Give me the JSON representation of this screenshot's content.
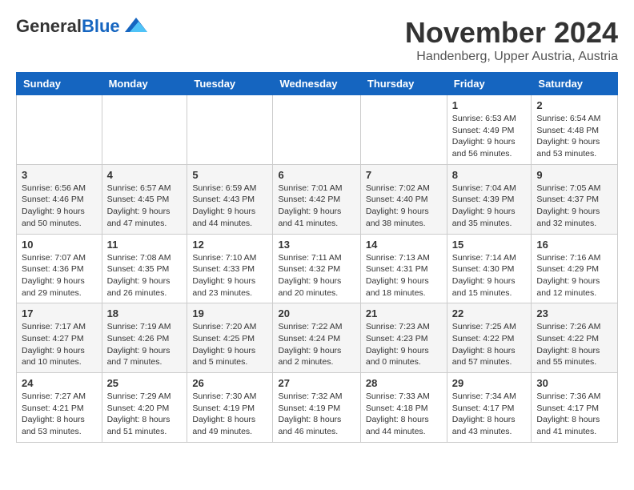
{
  "logo": {
    "general": "General",
    "blue": "Blue"
  },
  "title": "November 2024",
  "location": "Handenberg, Upper Austria, Austria",
  "days_of_week": [
    "Sunday",
    "Monday",
    "Tuesday",
    "Wednesday",
    "Thursday",
    "Friday",
    "Saturday"
  ],
  "weeks": [
    [
      {
        "day": "",
        "info": ""
      },
      {
        "day": "",
        "info": ""
      },
      {
        "day": "",
        "info": ""
      },
      {
        "day": "",
        "info": ""
      },
      {
        "day": "",
        "info": ""
      },
      {
        "day": "1",
        "info": "Sunrise: 6:53 AM\nSunset: 4:49 PM\nDaylight: 9 hours and 56 minutes."
      },
      {
        "day": "2",
        "info": "Sunrise: 6:54 AM\nSunset: 4:48 PM\nDaylight: 9 hours and 53 minutes."
      }
    ],
    [
      {
        "day": "3",
        "info": "Sunrise: 6:56 AM\nSunset: 4:46 PM\nDaylight: 9 hours and 50 minutes."
      },
      {
        "day": "4",
        "info": "Sunrise: 6:57 AM\nSunset: 4:45 PM\nDaylight: 9 hours and 47 minutes."
      },
      {
        "day": "5",
        "info": "Sunrise: 6:59 AM\nSunset: 4:43 PM\nDaylight: 9 hours and 44 minutes."
      },
      {
        "day": "6",
        "info": "Sunrise: 7:01 AM\nSunset: 4:42 PM\nDaylight: 9 hours and 41 minutes."
      },
      {
        "day": "7",
        "info": "Sunrise: 7:02 AM\nSunset: 4:40 PM\nDaylight: 9 hours and 38 minutes."
      },
      {
        "day": "8",
        "info": "Sunrise: 7:04 AM\nSunset: 4:39 PM\nDaylight: 9 hours and 35 minutes."
      },
      {
        "day": "9",
        "info": "Sunrise: 7:05 AM\nSunset: 4:37 PM\nDaylight: 9 hours and 32 minutes."
      }
    ],
    [
      {
        "day": "10",
        "info": "Sunrise: 7:07 AM\nSunset: 4:36 PM\nDaylight: 9 hours and 29 minutes."
      },
      {
        "day": "11",
        "info": "Sunrise: 7:08 AM\nSunset: 4:35 PM\nDaylight: 9 hours and 26 minutes."
      },
      {
        "day": "12",
        "info": "Sunrise: 7:10 AM\nSunset: 4:33 PM\nDaylight: 9 hours and 23 minutes."
      },
      {
        "day": "13",
        "info": "Sunrise: 7:11 AM\nSunset: 4:32 PM\nDaylight: 9 hours and 20 minutes."
      },
      {
        "day": "14",
        "info": "Sunrise: 7:13 AM\nSunset: 4:31 PM\nDaylight: 9 hours and 18 minutes."
      },
      {
        "day": "15",
        "info": "Sunrise: 7:14 AM\nSunset: 4:30 PM\nDaylight: 9 hours and 15 minutes."
      },
      {
        "day": "16",
        "info": "Sunrise: 7:16 AM\nSunset: 4:29 PM\nDaylight: 9 hours and 12 minutes."
      }
    ],
    [
      {
        "day": "17",
        "info": "Sunrise: 7:17 AM\nSunset: 4:27 PM\nDaylight: 9 hours and 10 minutes."
      },
      {
        "day": "18",
        "info": "Sunrise: 7:19 AM\nSunset: 4:26 PM\nDaylight: 9 hours and 7 minutes."
      },
      {
        "day": "19",
        "info": "Sunrise: 7:20 AM\nSunset: 4:25 PM\nDaylight: 9 hours and 5 minutes."
      },
      {
        "day": "20",
        "info": "Sunrise: 7:22 AM\nSunset: 4:24 PM\nDaylight: 9 hours and 2 minutes."
      },
      {
        "day": "21",
        "info": "Sunrise: 7:23 AM\nSunset: 4:23 PM\nDaylight: 9 hours and 0 minutes."
      },
      {
        "day": "22",
        "info": "Sunrise: 7:25 AM\nSunset: 4:22 PM\nDaylight: 8 hours and 57 minutes."
      },
      {
        "day": "23",
        "info": "Sunrise: 7:26 AM\nSunset: 4:22 PM\nDaylight: 8 hours and 55 minutes."
      }
    ],
    [
      {
        "day": "24",
        "info": "Sunrise: 7:27 AM\nSunset: 4:21 PM\nDaylight: 8 hours and 53 minutes."
      },
      {
        "day": "25",
        "info": "Sunrise: 7:29 AM\nSunset: 4:20 PM\nDaylight: 8 hours and 51 minutes."
      },
      {
        "day": "26",
        "info": "Sunrise: 7:30 AM\nSunset: 4:19 PM\nDaylight: 8 hours and 49 minutes."
      },
      {
        "day": "27",
        "info": "Sunrise: 7:32 AM\nSunset: 4:19 PM\nDaylight: 8 hours and 46 minutes."
      },
      {
        "day": "28",
        "info": "Sunrise: 7:33 AM\nSunset: 4:18 PM\nDaylight: 8 hours and 44 minutes."
      },
      {
        "day": "29",
        "info": "Sunrise: 7:34 AM\nSunset: 4:17 PM\nDaylight: 8 hours and 43 minutes."
      },
      {
        "day": "30",
        "info": "Sunrise: 7:36 AM\nSunset: 4:17 PM\nDaylight: 8 hours and 41 minutes."
      }
    ]
  ]
}
